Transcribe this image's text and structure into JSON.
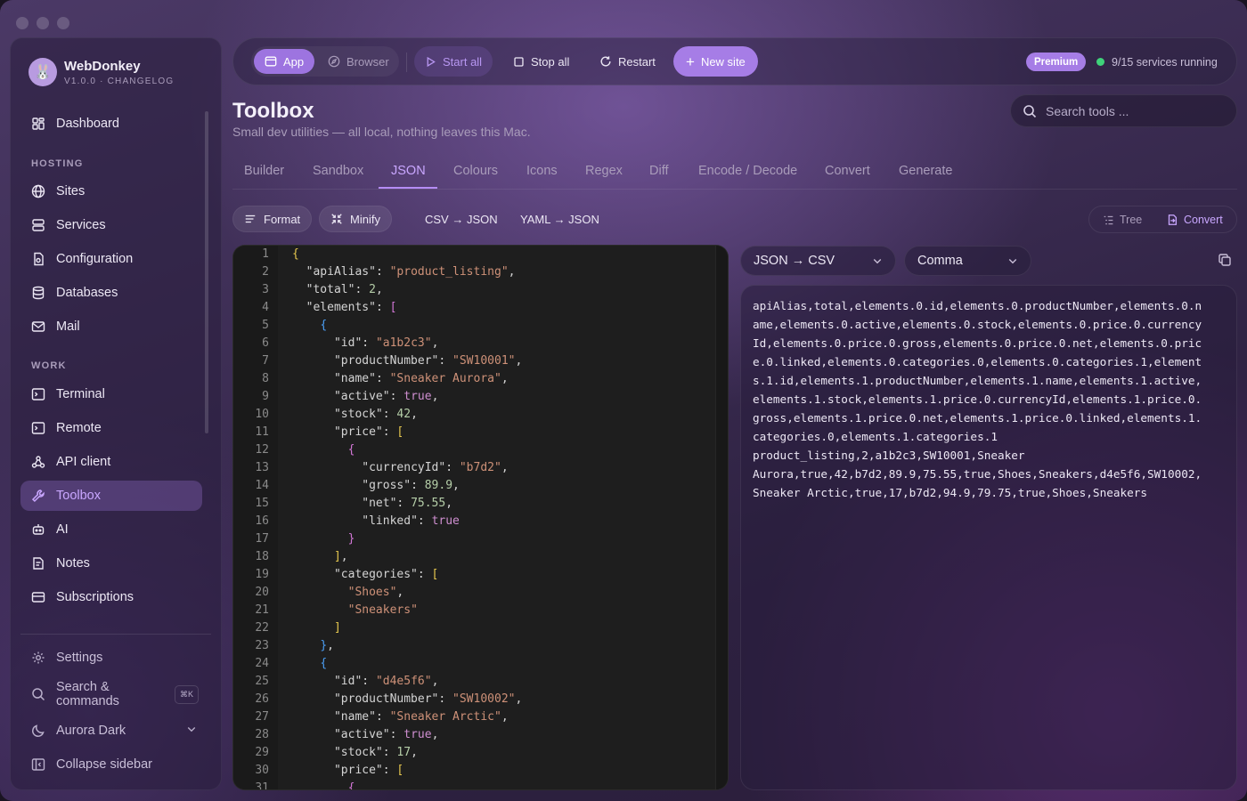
{
  "app": {
    "name": "WebDonkey",
    "version": "V1.0.0 · CHANGELOG"
  },
  "sidebar": {
    "top": [
      {
        "label": "Dashboard",
        "icon": "dashboard-icon"
      }
    ],
    "hosting_label": "HOSTING",
    "hosting": [
      {
        "label": "Sites",
        "icon": "globe-icon"
      },
      {
        "label": "Services",
        "icon": "server-icon"
      },
      {
        "label": "Configuration",
        "icon": "config-file-icon"
      },
      {
        "label": "Databases",
        "icon": "database-icon"
      },
      {
        "label": "Mail",
        "icon": "mail-icon"
      }
    ],
    "work_label": "WORK",
    "work": [
      {
        "label": "Terminal",
        "icon": "terminal-icon"
      },
      {
        "label": "Remote",
        "icon": "remote-terminal-icon"
      },
      {
        "label": "API client",
        "icon": "webhook-icon"
      },
      {
        "label": "Toolbox",
        "icon": "wrench-icon",
        "active": true
      },
      {
        "label": "AI",
        "icon": "robot-icon"
      },
      {
        "label": "Notes",
        "icon": "notes-icon"
      },
      {
        "label": "Subscriptions",
        "icon": "card-icon"
      }
    ],
    "settings": "Settings",
    "search_commands": "Search & commands",
    "search_shortcut": "⌘K",
    "theme": "Aurora Dark",
    "collapse": "Collapse sidebar"
  },
  "topbar": {
    "app": "App",
    "browser": "Browser",
    "start_all": "Start all",
    "stop_all": "Stop all",
    "restart": "Restart",
    "new_site": "New site",
    "premium": "Premium",
    "status": "9/15 services running"
  },
  "page": {
    "title": "Toolbox",
    "subtitle": "Small dev utilities — all local, nothing leaves this Mac.",
    "search_placeholder": "Search tools ..."
  },
  "tabs": [
    "Builder",
    "Sandbox",
    "JSON",
    "Colours",
    "Icons",
    "Regex",
    "Diff",
    "Encode / Decode",
    "Convert",
    "Generate"
  ],
  "active_tab": "JSON",
  "tools": {
    "format": "Format",
    "minify": "Minify",
    "csv_json": "CSV → JSON",
    "yaml_json": "YAML → JSON",
    "tree": "Tree",
    "convert": "Convert"
  },
  "converter": {
    "mode": "JSON → CSV",
    "delimiter": "Comma"
  },
  "editor_lines": [
    "{",
    "  \"apiAlias\": \"product_listing\",",
    "  \"total\": 2,",
    "  \"elements\": [",
    "    {",
    "      \"id\": \"a1b2c3\",",
    "      \"productNumber\": \"SW10001\",",
    "      \"name\": \"Sneaker Aurora\",",
    "      \"active\": true,",
    "      \"stock\": 42,",
    "      \"price\": [",
    "        {",
    "          \"currencyId\": \"b7d2\",",
    "          \"gross\": 89.9,",
    "          \"net\": 75.55,",
    "          \"linked\": true",
    "        }",
    "      ],",
    "      \"categories\": [",
    "        \"Shoes\",",
    "        \"Sneakers\"",
    "      ]",
    "    },",
    "    {",
    "      \"id\": \"d4e5f6\",",
    "      \"productNumber\": \"SW10002\",",
    "      \"name\": \"Sneaker Arctic\",",
    "      \"active\": true,",
    "      \"stock\": 17,",
    "      \"price\": [",
    "        {"
  ],
  "output_lines": [
    "apiAlias,total,elements.0.id,elements.0.productNumber,elements.0.n",
    "ame,elements.0.active,elements.0.stock,elements.0.price.0.currency",
    "Id,elements.0.price.0.gross,elements.0.price.0.net,elements.0.pric",
    "e.0.linked,elements.0.categories.0,elements.0.categories.1,element",
    "s.1.id,elements.1.productNumber,elements.1.name,elements.1.active,",
    "elements.1.stock,elements.1.price.0.currencyId,elements.1.price.0.",
    "gross,elements.1.price.0.net,elements.1.price.0.linked,elements.1.",
    "categories.0,elements.1.categories.1",
    "product_listing,2,a1b2c3,SW10001,Sneaker",
    "Aurora,true,42,b7d2,89.9,75.55,true,Shoes,Sneakers,d4e5f6,SW10002,",
    "Sneaker Arctic,true,17,b7d2,94.9,79.75,true,Shoes,Sneakers"
  ],
  "colors": {
    "accent": "#a67de6",
    "active_text": "#c9a7ff",
    "running_dot": "#3fd27a"
  }
}
